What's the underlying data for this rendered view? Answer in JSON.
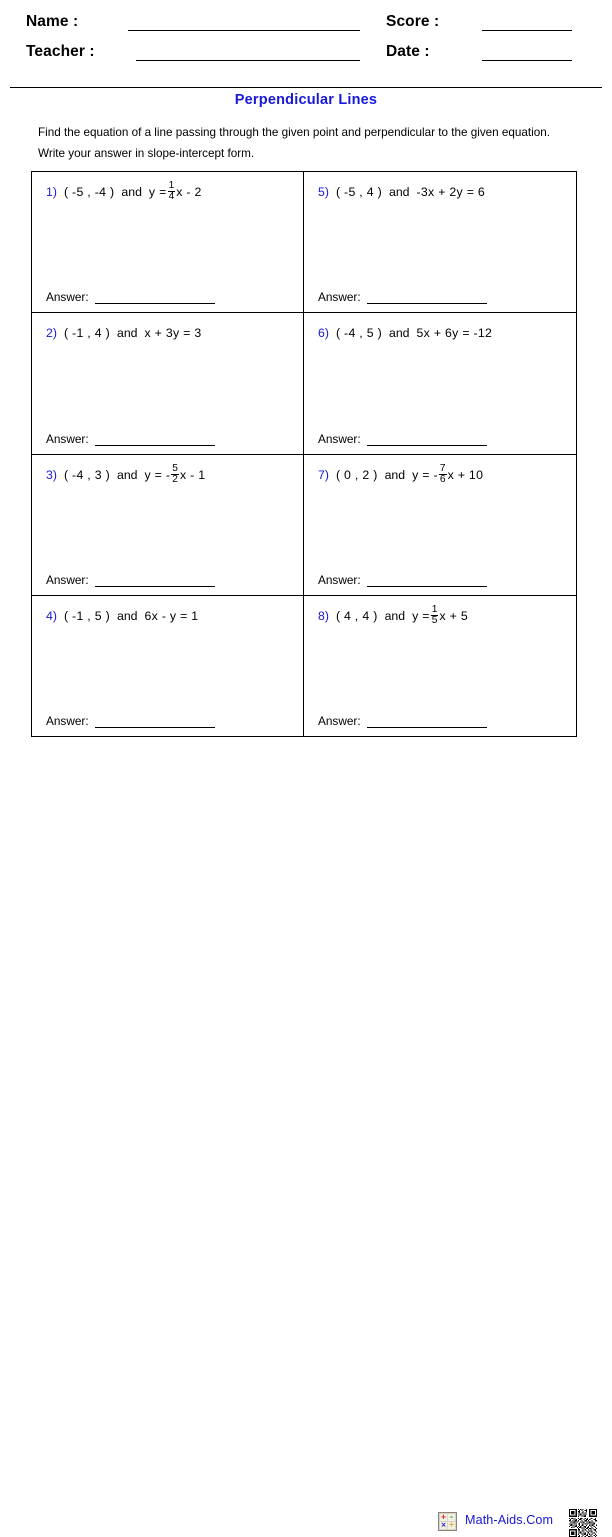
{
  "header": {
    "name_label": "Name :",
    "teacher_label": "Teacher :",
    "score_label": "Score :",
    "date_label": "Date :",
    "name_value": "",
    "teacher_value": "",
    "score_value": "",
    "date_value": ""
  },
  "title": "Perpendicular Lines",
  "title_color": "#1818d8",
  "instructions": {
    "line1": "Find the equation of a line passing through the given point and perpendicular to the given equation.",
    "line2": "Write your answer in slope-intercept form."
  },
  "answer_label": "Answer:",
  "connector": "and",
  "problems": [
    {
      "number": "1)",
      "point": "( -5 , -4 )",
      "equation_prefix": "y =",
      "fraction": {
        "numerator": "1",
        "denominator": "4"
      },
      "equation_suffix": "x - 2",
      "equation_plain": "y = 1/4 x - 2",
      "answer": ""
    },
    {
      "number": "5)",
      "point": "( -5 , 4 )",
      "equation_prefix": "-3x + 2y = 6",
      "fraction": null,
      "equation_suffix": "",
      "equation_plain": "-3x + 2y = 6",
      "answer": ""
    },
    {
      "number": "2)",
      "point": "( -1 , 4 )",
      "equation_prefix": "x + 3y = 3",
      "fraction": null,
      "equation_suffix": "",
      "equation_plain": "x + 3y = 3",
      "answer": ""
    },
    {
      "number": "6)",
      "point": "( -4 , 5 )",
      "equation_prefix": "5x + 6y = -12",
      "fraction": null,
      "equation_suffix": "",
      "equation_plain": "5x + 6y = -12",
      "answer": ""
    },
    {
      "number": "3)",
      "point": "( -4 , 3 )",
      "equation_prefix": "y = -",
      "fraction": {
        "numerator": "5",
        "denominator": "2"
      },
      "equation_suffix": "x - 1",
      "equation_plain": "y = -5/2 x - 1",
      "answer": ""
    },
    {
      "number": "7)",
      "point": "( 0 , 2 )",
      "equation_prefix": "y = -",
      "fraction": {
        "numerator": "7",
        "denominator": "6"
      },
      "equation_suffix": "x + 10",
      "equation_plain": "y = -7/6 x + 10",
      "answer": ""
    },
    {
      "number": "4)",
      "point": "( -1 , 5 )",
      "equation_prefix": "6x - y = 1",
      "fraction": null,
      "equation_suffix": "",
      "equation_plain": "6x - y = 1",
      "answer": ""
    },
    {
      "number": "8)",
      "point": "( 4 , 4 )",
      "equation_prefix": "y =",
      "fraction": {
        "numerator": "1",
        "denominator": "5"
      },
      "equation_suffix": "x + 5",
      "equation_plain": "y = 1/5 x + 5",
      "answer": ""
    }
  ],
  "footer": {
    "brand": "Math-Aids.Com",
    "brand_color": "#1818d8",
    "calculator_keys": [
      "+",
      "–",
      "×",
      "÷"
    ]
  }
}
